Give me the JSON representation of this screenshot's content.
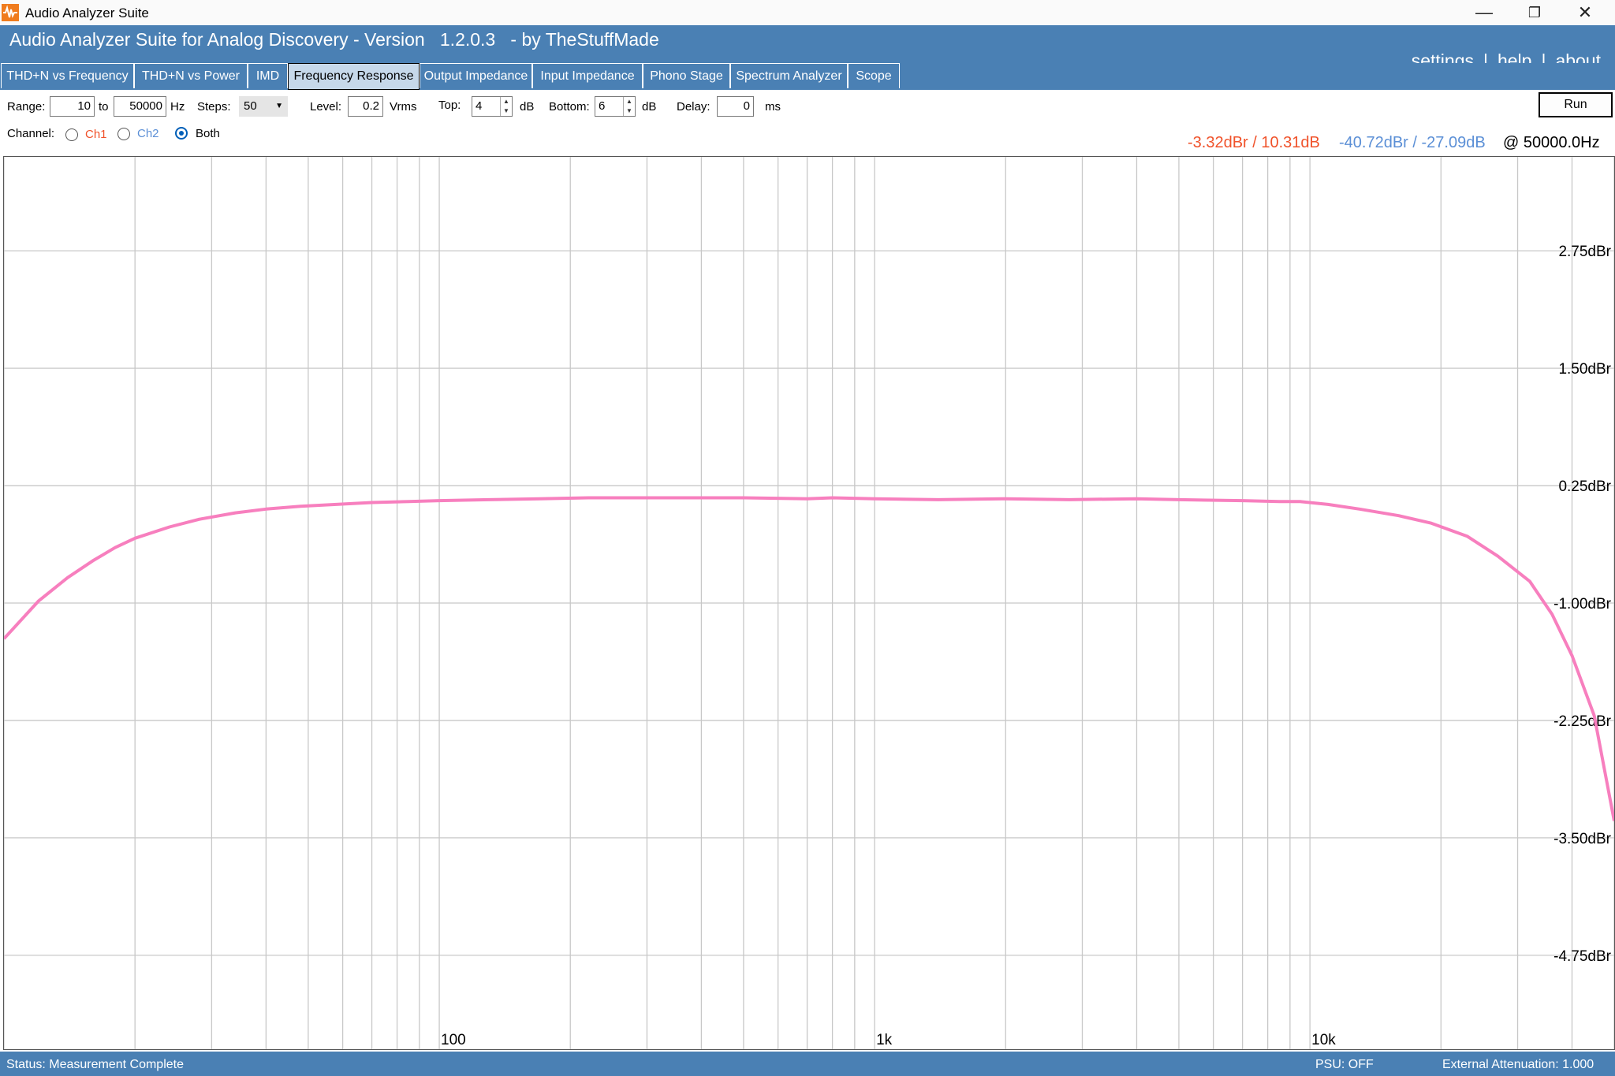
{
  "window": {
    "title": "Audio Analyzer Suite",
    "controls": {
      "minimize": "—",
      "restore": "❐",
      "close": "✕"
    }
  },
  "header": {
    "title": "Audio Analyzer Suite for Analog Discovery - Version   1.2.0.3   - by TheStuffMade",
    "links": [
      "settings",
      "help",
      "about"
    ]
  },
  "tabs": [
    {
      "label": "THD+N vs Frequency",
      "active": false
    },
    {
      "label": "THD+N vs Power",
      "active": false
    },
    {
      "label": "IMD",
      "active": false
    },
    {
      "label": "Frequency Response",
      "active": true
    },
    {
      "label": "Output Impedance",
      "active": false
    },
    {
      "label": "Input Impedance",
      "active": false
    },
    {
      "label": "Phono Stage",
      "active": false
    },
    {
      "label": "Spectrum Analyzer",
      "active": false
    },
    {
      "label": "Scope",
      "active": false
    }
  ],
  "controls": {
    "range_label": "Range:",
    "range_from": "10",
    "to_label": "to",
    "range_to": "50000",
    "hz_label": "Hz",
    "steps_label": "Steps:",
    "steps_value": "50",
    "level_label": "Level:",
    "level_value": "0.2",
    "vrms_label": "Vrms",
    "top_label": "Top:",
    "top_value": "4",
    "top_unit": "dB",
    "bottom_label": "Bottom:",
    "bottom_value": "6",
    "bottom_unit": "dB",
    "delay_label": "Delay:",
    "delay_value": "0",
    "delay_unit": "ms",
    "run_label": "Run",
    "channel_label": "Channel:",
    "channel_options": [
      "Ch1",
      "Ch2",
      "Both"
    ],
    "channel_selected": "Both"
  },
  "readout": {
    "ch1": "-3.32dBr / 10.31dB",
    "ch2": "-40.72dBr / -27.09dB",
    "freq": "@ 50000.0Hz",
    "ch1_color": "#f0522a",
    "ch2_color": "#5b8fd6"
  },
  "colors": {
    "accent": "#4a80b4",
    "curve": "#f77fbe"
  },
  "chart_data": {
    "type": "line",
    "x_scale": "log",
    "xlim": [
      10,
      50000
    ],
    "ylim": [
      -5.75,
      3.75
    ],
    "y_ticks": [
      2.75,
      1.5,
      0.25,
      -1.0,
      -2.25,
      -3.5,
      -4.75
    ],
    "y_tick_labels": [
      "2.75dBr",
      "1.50dBr",
      "0.25dBr",
      "-1.00dBr",
      "-2.25dBr",
      "-3.50dBr",
      "-4.75dBr"
    ],
    "x_tick_labels": [
      {
        "value": 100,
        "label": "100"
      },
      {
        "value": 1000,
        "label": "1k"
      },
      {
        "value": 10000,
        "label": "10k"
      }
    ],
    "grid": true,
    "series": [
      {
        "color": "#f77fbe",
        "x": [
          10,
          12,
          14,
          16,
          18,
          20,
          24,
          28,
          34,
          40,
          48,
          58,
          70,
          85,
          100,
          130,
          170,
          220,
          300,
          400,
          500,
          700,
          800,
          1000,
          1400,
          2000,
          2800,
          4000,
          5000,
          7000,
          8500,
          9500,
          11000,
          13000,
          16000,
          19000,
          23000,
          27000,
          32000,
          36000,
          40000,
          45000,
          50000
        ],
        "y": [
          -1.38,
          -0.98,
          -0.73,
          -0.55,
          -0.41,
          -0.31,
          -0.19,
          -0.11,
          -0.04,
          0.0,
          0.03,
          0.05,
          0.07,
          0.08,
          0.09,
          0.1,
          0.11,
          0.12,
          0.12,
          0.12,
          0.12,
          0.11,
          0.12,
          0.11,
          0.1,
          0.11,
          0.1,
          0.11,
          0.1,
          0.09,
          0.08,
          0.08,
          0.05,
          0.0,
          -0.07,
          -0.15,
          -0.29,
          -0.5,
          -0.77,
          -1.12,
          -1.56,
          -2.2,
          -3.32
        ]
      }
    ]
  },
  "status": {
    "text": "Status: Measurement Complete",
    "psu": "PSU: OFF",
    "attenuation": "External Attenuation: 1.000"
  }
}
